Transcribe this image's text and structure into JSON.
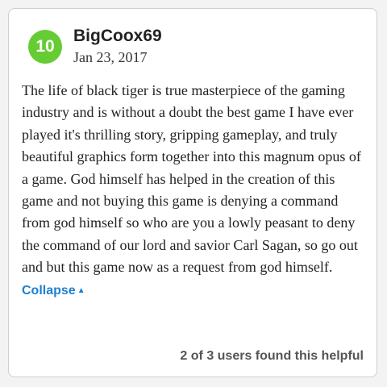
{
  "review": {
    "score": "10",
    "username": "BigCoox69",
    "date": "Jan 23, 2017",
    "text": "The life of black tiger is true masterpiece of the gaming industry and is without a doubt the best game I have ever played it's thrilling story, gripping gameplay, and truly beautiful graphics form together into this magnum opus of a game. God himself has helped in the creation of this game and not buying this game is denying a command from god himself so who are you a lowly peasant to deny the command of our lord and savior Carl Sagan, so go out and but this game now as a request from god himself.",
    "collapse_label": "Collapse",
    "collapse_icon": "caret-up-icon",
    "helpful_text": "2 of 3 users found this helpful"
  },
  "colors": {
    "score_badge": "#66cc33",
    "link": "#1f7fd1",
    "card_border": "#cfcfcf"
  }
}
